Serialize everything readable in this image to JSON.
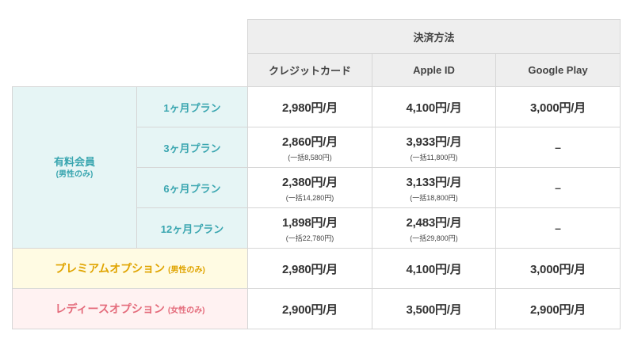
{
  "header": {
    "payment_method": "決済方法",
    "columns": [
      "クレジットカード",
      "Apple ID",
      "Google Play"
    ]
  },
  "member": {
    "label": "有料会員",
    "sub": "(男性のみ)"
  },
  "plans": [
    {
      "name": "1ヶ月プラン",
      "credit": "2,980円/月",
      "credit_note": "",
      "apple": "4,100円/月",
      "apple_note": "",
      "google": "3,000円/月"
    },
    {
      "name": "3ヶ月プラン",
      "credit": "2,860円/月",
      "credit_note": "(一括8,580円)",
      "apple": "3,933円/月",
      "apple_note": "(一括11,800円)",
      "google": "–"
    },
    {
      "name": "6ヶ月プラン",
      "credit": "2,380円/月",
      "credit_note": "(一括14,280円)",
      "apple": "3,133円/月",
      "apple_note": "(一括18,800円)",
      "google": "–"
    },
    {
      "name": "12ヶ月プラン",
      "credit": "1,898円/月",
      "credit_note": "(一括22,780円)",
      "apple": "2,483円/月",
      "apple_note": "(一括29,800円)",
      "google": "–"
    }
  ],
  "premium": {
    "name": "プレミアムオプション",
    "note": "(男性のみ)",
    "credit": "2,980円/月",
    "apple": "4,100円/月",
    "google": "3,000円/月"
  },
  "ladies": {
    "name": "レディースオプション",
    "note": "(女性のみ)",
    "credit": "2,900円/月",
    "apple": "3,500円/月",
    "google": "2,900円/月"
  }
}
